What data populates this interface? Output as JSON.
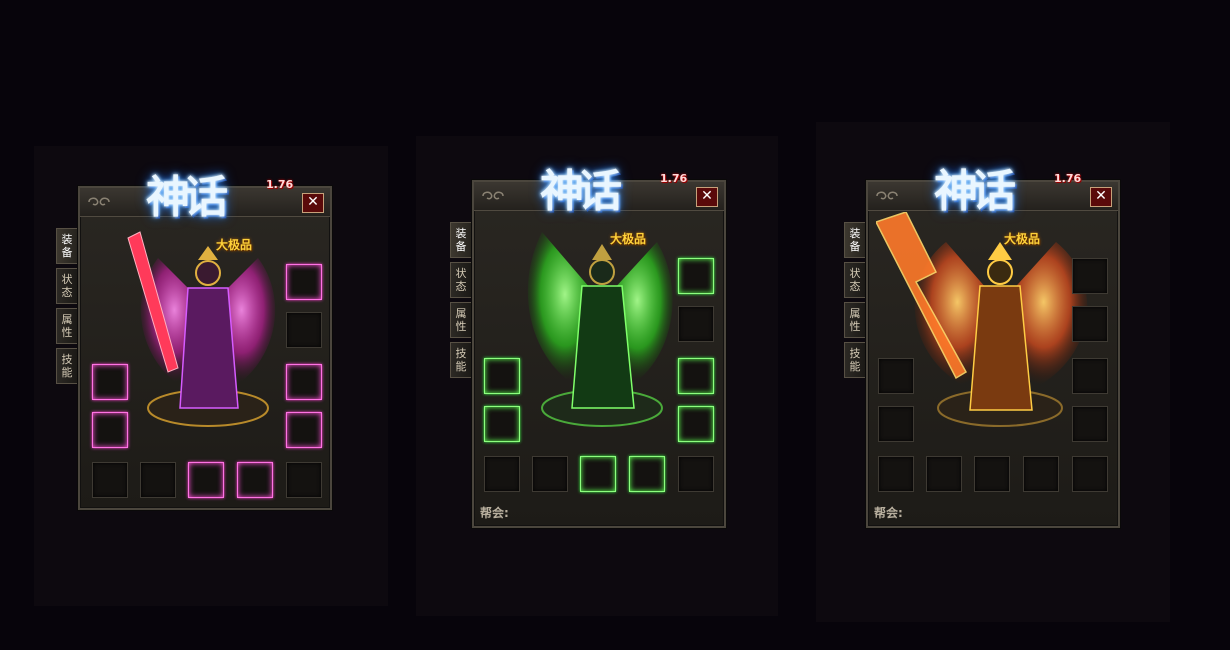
{
  "panels": [
    {
      "logo": "神话",
      "version": "1.76",
      "subtitle": "大极品",
      "close_label": "✕",
      "tabs": [
        "装备",
        "状态",
        "属性",
        "技能"
      ],
      "theme_color": "#ff3fcf",
      "guild_label": ""
    },
    {
      "logo": "神话",
      "version": "1.76",
      "subtitle": "大极品",
      "close_label": "✕",
      "tabs": [
        "装备",
        "状态",
        "属性",
        "技能"
      ],
      "theme_color": "#3fff3a",
      "guild_label": "帮会:"
    },
    {
      "logo": "神话",
      "version": "1.76",
      "subtitle": "大极品",
      "close_label": "✕",
      "tabs": [
        "装备",
        "状态",
        "属性",
        "技能"
      ],
      "theme_color": "#ff6a1a",
      "guild_label": "帮会:"
    }
  ]
}
